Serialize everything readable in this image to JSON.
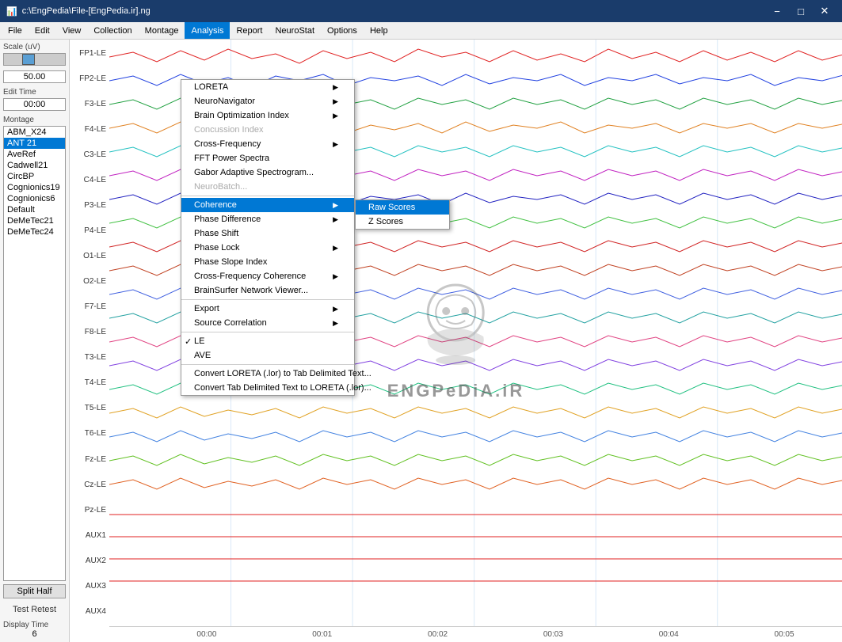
{
  "window": {
    "title": "c:\\EngPedia\\File-[EngPedia.ir].ng",
    "icon": "📊"
  },
  "titlebar": {
    "minimize": "−",
    "maximize": "□",
    "close": "✕"
  },
  "menubar": {
    "items": [
      "File",
      "Edit",
      "View",
      "Collection",
      "Montage",
      "Analysis",
      "Report",
      "NeuroStat",
      "Options",
      "Help"
    ]
  },
  "left_panel": {
    "scale_label": "Scale (uV)",
    "scale_value": "50.00",
    "edit_time_label": "Edit Time",
    "edit_time_value": "00:00",
    "montage_label": "Montage",
    "montage_items": [
      "ABM_X24",
      "ANT 21",
      "AveRef",
      "Cadwell21",
      "CircBP",
      "Cognionics19",
      "Cognionics6",
      "Default",
      "DeMeTec21",
      "DeMeTec24"
    ],
    "split_half": "Split Half",
    "test_retest": "Test Retest",
    "display_time_label": "Display Time",
    "display_time_value": "6"
  },
  "channels": [
    "FP1-LE",
    "FP2-LE",
    "F3-LE",
    "F4-LE",
    "C3-LE",
    "C4-LE",
    "P3-LE",
    "P4-LE",
    "O1-LE",
    "O2-LE",
    "F7-LE",
    "F8-LE",
    "T3-LE",
    "T4-LE",
    "T5-LE",
    "T6-LE",
    "Fz-LE",
    "Cz-LE",
    "Pz-LE",
    "AUX1",
    "AUX2",
    "AUX3",
    "AUX4"
  ],
  "time_ticks": [
    "00:00",
    "00:01",
    "00:02",
    "00:03",
    "00:04",
    "00:05"
  ],
  "analysis_menu": {
    "items": [
      {
        "label": "LORETA",
        "has_arrow": true,
        "disabled": false
      },
      {
        "label": "NeuroNavigator",
        "has_arrow": true,
        "disabled": false
      },
      {
        "label": "Brain Optimization Index",
        "has_arrow": true,
        "disabled": false
      },
      {
        "label": "Concussion Index",
        "has_arrow": false,
        "disabled": true
      },
      {
        "label": "Cross-Frequency",
        "has_arrow": true,
        "disabled": false
      },
      {
        "label": "FFT Power Spectra",
        "has_arrow": false,
        "disabled": false
      },
      {
        "label": "Gabor Adaptive Spectrogram...",
        "has_arrow": false,
        "disabled": false
      },
      {
        "label": "NeuroBatch...",
        "has_arrow": false,
        "disabled": true
      },
      {
        "label": "Coherence",
        "has_arrow": true,
        "disabled": false,
        "highlighted": true
      },
      {
        "label": "Phase Difference",
        "has_arrow": true,
        "disabled": false
      },
      {
        "label": "Phase Shift",
        "has_arrow": false,
        "disabled": false
      },
      {
        "label": "Phase Lock",
        "has_arrow": true,
        "disabled": false
      },
      {
        "label": "Phase Slope Index",
        "has_arrow": false,
        "disabled": false
      },
      {
        "label": "Cross-Frequency Coherence",
        "has_arrow": true,
        "disabled": false
      },
      {
        "label": "BrainSurfer Network Viewer...",
        "has_arrow": false,
        "disabled": false
      },
      {
        "label": "Export",
        "has_arrow": true,
        "disabled": false
      },
      {
        "label": "Source Correlation",
        "has_arrow": true,
        "disabled": false
      },
      {
        "label": "LE",
        "has_arrow": false,
        "checked": true,
        "disabled": false
      },
      {
        "label": "AVE",
        "has_arrow": false,
        "disabled": false
      },
      {
        "label": "Convert LORETA (.lor) to Tab Delimited Text...",
        "has_arrow": false,
        "disabled": false
      },
      {
        "label": "Convert Tab Delimited Text to LORETA (.lor)...",
        "has_arrow": false,
        "disabled": false
      }
    ]
  },
  "coherence_submenu": {
    "items": [
      {
        "label": "Raw Scores",
        "highlighted": true
      },
      {
        "label": "Z Scores"
      }
    ]
  },
  "power_spectra_label": "Power Spectra",
  "raw_scores_label": "Raw Scores",
  "concussion_index_label": "Concussion Index",
  "brain_optimization_label": "Brain Optimization Index",
  "export_source_label": "Export Source Correlation",
  "ant21_label": "ANT 21",
  "collection_label": "Collection"
}
